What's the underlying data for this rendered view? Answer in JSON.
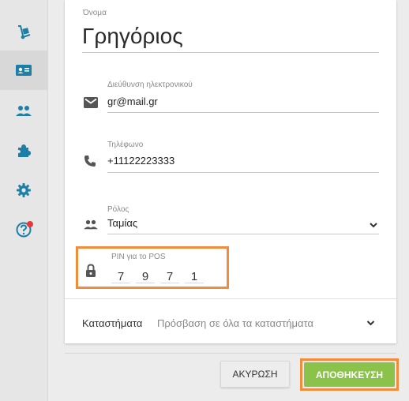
{
  "sidebar": {
    "items": [
      {
        "icon": "hand-truck-icon",
        "active": false
      },
      {
        "icon": "id-card-icon",
        "active": true
      },
      {
        "icon": "people-icon",
        "active": false
      },
      {
        "icon": "puzzle-icon",
        "active": false
      },
      {
        "icon": "gear-icon",
        "active": false
      },
      {
        "icon": "help-icon",
        "active": false,
        "badge": true
      }
    ],
    "accent": "#1e7fa6"
  },
  "form": {
    "name": {
      "label": "Όνομα",
      "value": "Γρηγόριος"
    },
    "email": {
      "label": "Διεύθυνση ηλεκτρονικού",
      "value": "gr@mail.gr"
    },
    "phone": {
      "label": "Τηλέφωνο",
      "value": "+11122223333"
    },
    "role": {
      "label": "Ρόλος",
      "value": "Ταμίας"
    },
    "pin": {
      "label": "PIN για το POS",
      "digits": [
        "7",
        "9",
        "7",
        "1"
      ]
    },
    "stores": {
      "label": "Καταστήματα",
      "value": "Πρόσβαση σε όλα τα καταστήματα"
    }
  },
  "actions": {
    "cancel_label": "ΑΚΥΡΩΣΗ",
    "save_label": "ΑΠΟΘΗΚΕΥΣΗ"
  },
  "colors": {
    "highlight": "#f08c3a",
    "save": "#8bc34a",
    "badge": "#e53935"
  }
}
